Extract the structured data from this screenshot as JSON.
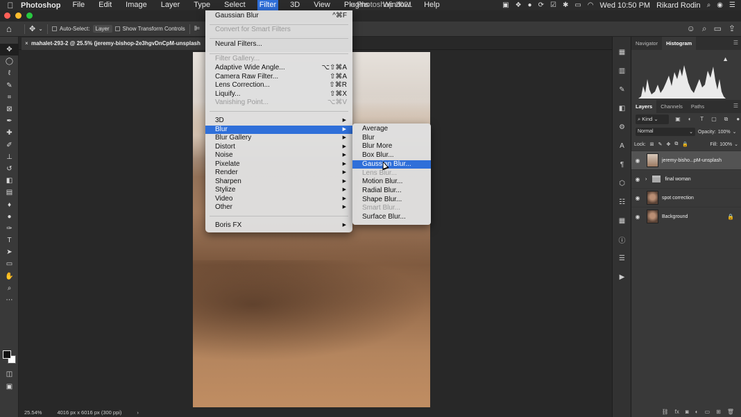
{
  "menubar": {
    "apple": "",
    "app": "Photoshop",
    "items": [
      "File",
      "Edit",
      "Image",
      "Layer",
      "Type",
      "Select",
      "Filter",
      "3D",
      "View",
      "Plugins",
      "Window",
      "Help"
    ],
    "active": "Filter",
    "window_title_partial": "e Photoshop 2021",
    "clock": "Wed 10:50 PM",
    "user": "Rikard Rodin"
  },
  "options_bar": {
    "auto_select_label": "Auto-Select:",
    "auto_select_value": "Layer",
    "show_transform_label": "Show Transform Controls"
  },
  "document": {
    "tab_title": "mahalet-293-2 @ 25.5% (jeremy-bishop-2e3hgvDnCpM-unsplash",
    "zoom": "25.54%",
    "dimensions": "4016 px x 6016 px (300 ppi)"
  },
  "filter_menu": {
    "items": [
      {
        "label": "Gaussian Blur",
        "shortcut": "^⌘F"
      },
      {
        "label": "Convert for Smart Filters",
        "disabled": true
      },
      {
        "label": "Neural Filters..."
      },
      {
        "label": "Filter Gallery...",
        "disabled": true
      },
      {
        "label": "Adaptive Wide Angle...",
        "shortcut": "⌥⇧⌘A"
      },
      {
        "label": "Camera Raw Filter...",
        "shortcut": "⇧⌘A"
      },
      {
        "label": "Lens Correction...",
        "shortcut": "⇧⌘R"
      },
      {
        "label": "Liquify...",
        "shortcut": "⇧⌘X"
      },
      {
        "label": "Vanishing Point...",
        "shortcut": "⌥⌘V",
        "disabled": true
      },
      {
        "label": "3D",
        "submenu": true
      },
      {
        "label": "Blur",
        "submenu": true,
        "highlighted": true
      },
      {
        "label": "Blur Gallery",
        "submenu": true
      },
      {
        "label": "Distort",
        "submenu": true
      },
      {
        "label": "Noise",
        "submenu": true
      },
      {
        "label": "Pixelate",
        "submenu": true
      },
      {
        "label": "Render",
        "submenu": true
      },
      {
        "label": "Sharpen",
        "submenu": true
      },
      {
        "label": "Stylize",
        "submenu": true
      },
      {
        "label": "Video",
        "submenu": true
      },
      {
        "label": "Other",
        "submenu": true
      },
      {
        "label": "Boris FX",
        "submenu": true
      }
    ]
  },
  "blur_submenu": {
    "items": [
      {
        "label": "Average"
      },
      {
        "label": "Blur"
      },
      {
        "label": "Blur More"
      },
      {
        "label": "Box Blur..."
      },
      {
        "label": "Gaussian Blur...",
        "highlighted": true
      },
      {
        "label": "Lens Blur...",
        "disabled": true
      },
      {
        "label": "Motion Blur..."
      },
      {
        "label": "Radial Blur..."
      },
      {
        "label": "Shape Blur..."
      },
      {
        "label": "Smart Blur...",
        "disabled": true
      },
      {
        "label": "Surface Blur..."
      }
    ]
  },
  "panels": {
    "top_tabs": [
      "Navigator",
      "Histogram"
    ],
    "top_active": "Histogram",
    "layer_tabs": [
      "Layers",
      "Channels",
      "Paths"
    ],
    "layer_active": "Layers",
    "filter_kind": "Kind",
    "blend_mode": "Normal",
    "opacity_label": "Opacity:",
    "opacity_value": "100%",
    "lock_label": "Lock:",
    "fill_label": "Fill:",
    "fill_value": "100%",
    "layers": [
      {
        "name": "jeremy-bisho...pM-unsplash",
        "selected": true,
        "type": "image"
      },
      {
        "name": "final woman",
        "type": "group"
      },
      {
        "name": "spot correction",
        "type": "portrait"
      },
      {
        "name": "Background",
        "type": "portrait",
        "locked": true
      }
    ]
  },
  "colors": {
    "menu_highlight": "#2f6fd9",
    "panel_bg": "#393939",
    "canvas_bg": "#282828"
  }
}
